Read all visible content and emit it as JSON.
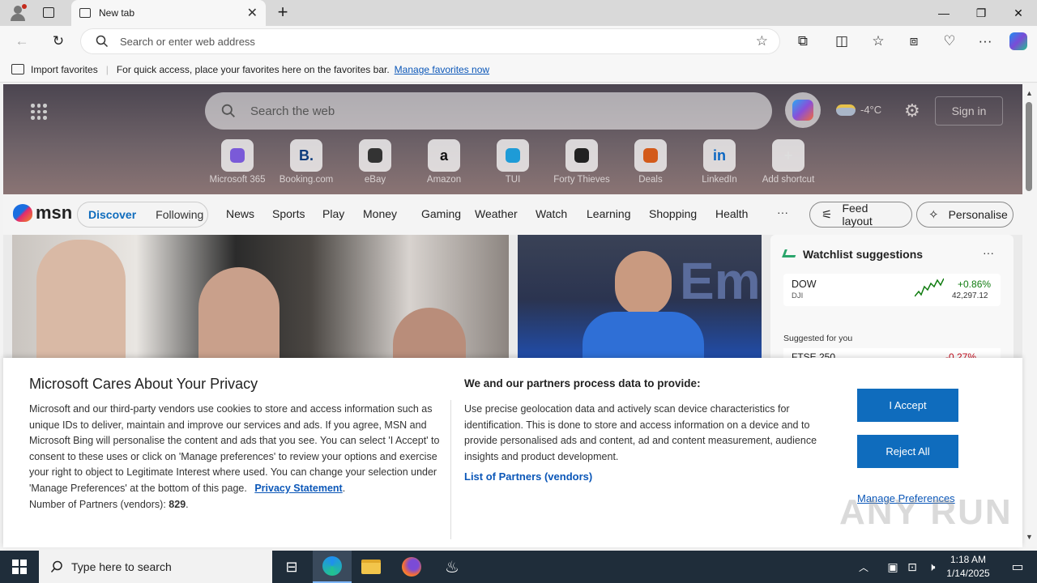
{
  "browser": {
    "tab_title": "New tab",
    "address_placeholder": "Search or enter web address"
  },
  "favbar": {
    "import_label": "Import favorites",
    "message": "For quick access, place your favorites here on the favorites bar.",
    "manage_link": "Manage favorites now"
  },
  "msn": {
    "search_placeholder": "Search the web",
    "weather_temp": "-4°C",
    "sign_in": "Sign in",
    "logo": "msn",
    "shortcuts": [
      {
        "label": "Microsoft 365",
        "icon": "m365-icon",
        "color": "#7a5ad8"
      },
      {
        "label": "Booking.com",
        "icon": "booking-icon",
        "color": "#0c3b7c",
        "glyph": "B."
      },
      {
        "label": "eBay",
        "icon": "ebay-icon",
        "color": "#333"
      },
      {
        "label": "Amazon",
        "icon": "amazon-icon",
        "color": "#111",
        "glyph": "a"
      },
      {
        "label": "TUI",
        "icon": "tui-icon",
        "color": "#1e9bd7"
      },
      {
        "label": "Forty Thieves",
        "icon": "forty-thieves-icon",
        "color": "#222"
      },
      {
        "label": "Deals",
        "icon": "deals-icon",
        "color": "#d35a1a"
      },
      {
        "label": "LinkedIn",
        "icon": "linkedin-icon",
        "color": "#0a66c2",
        "glyph": "in"
      },
      {
        "label": "Add shortcut",
        "icon": "plus-icon",
        "color": "#ddd",
        "glyph": "+"
      }
    ],
    "nav": {
      "discover": "Discover",
      "following": "Following",
      "items": [
        "News",
        "Sports",
        "Play",
        "Money",
        "Gaming",
        "Weather",
        "Watch",
        "Learning",
        "Shopping",
        "Health"
      ],
      "more": "···",
      "feed_layout": "Feed layout",
      "personalise": "Personalise"
    },
    "watchlist": {
      "title": "Watchlist suggestions",
      "stock_symbol": "DOW",
      "stock_sub": "DJI",
      "stock_change": "+0.86%",
      "stock_value": "42,297.12",
      "suggested": "Suggested for you",
      "next_symbol": "FTSE 250",
      "next_change": "-0.27%"
    }
  },
  "consent": {
    "title": "Microsoft Cares About Your Privacy",
    "body": "Microsoft and our third-party vendors use cookies to store and access information such as unique IDs to deliver, maintain and improve our services and ads. If you agree, MSN and Microsoft Bing will personalise the content and ads that you see. You can select 'I Accept' to consent to these uses or click on 'Manage preferences' to review your options and exercise your right to object to Legitimate Interest where used.  You can change your selection under 'Manage Preferences' at the bottom of this page.",
    "privacy_link": "Privacy Statement",
    "partners_label": "Number of Partners (vendors):",
    "partners_count": "829",
    "right_title": "We and our partners process data to provide:",
    "right_body": "Use precise geolocation data and actively scan device characteristics for identification. This is done to store and access information on a device and to provide personalised ads and content, ad and content measurement, audience insights and product development.",
    "partners_link": "List of Partners (vendors)",
    "accept": "I Accept",
    "reject": "Reject All",
    "manage": "Manage Preferences"
  },
  "taskbar": {
    "search_placeholder": "Type here to search",
    "time": "1:18 AM",
    "date": "1/14/2025"
  },
  "watermark": "ANY RUN",
  "colors": {
    "accent": "#0f6cbd",
    "link": "#0b57b8",
    "positive": "#107c10",
    "negative": "#c50f1f"
  }
}
